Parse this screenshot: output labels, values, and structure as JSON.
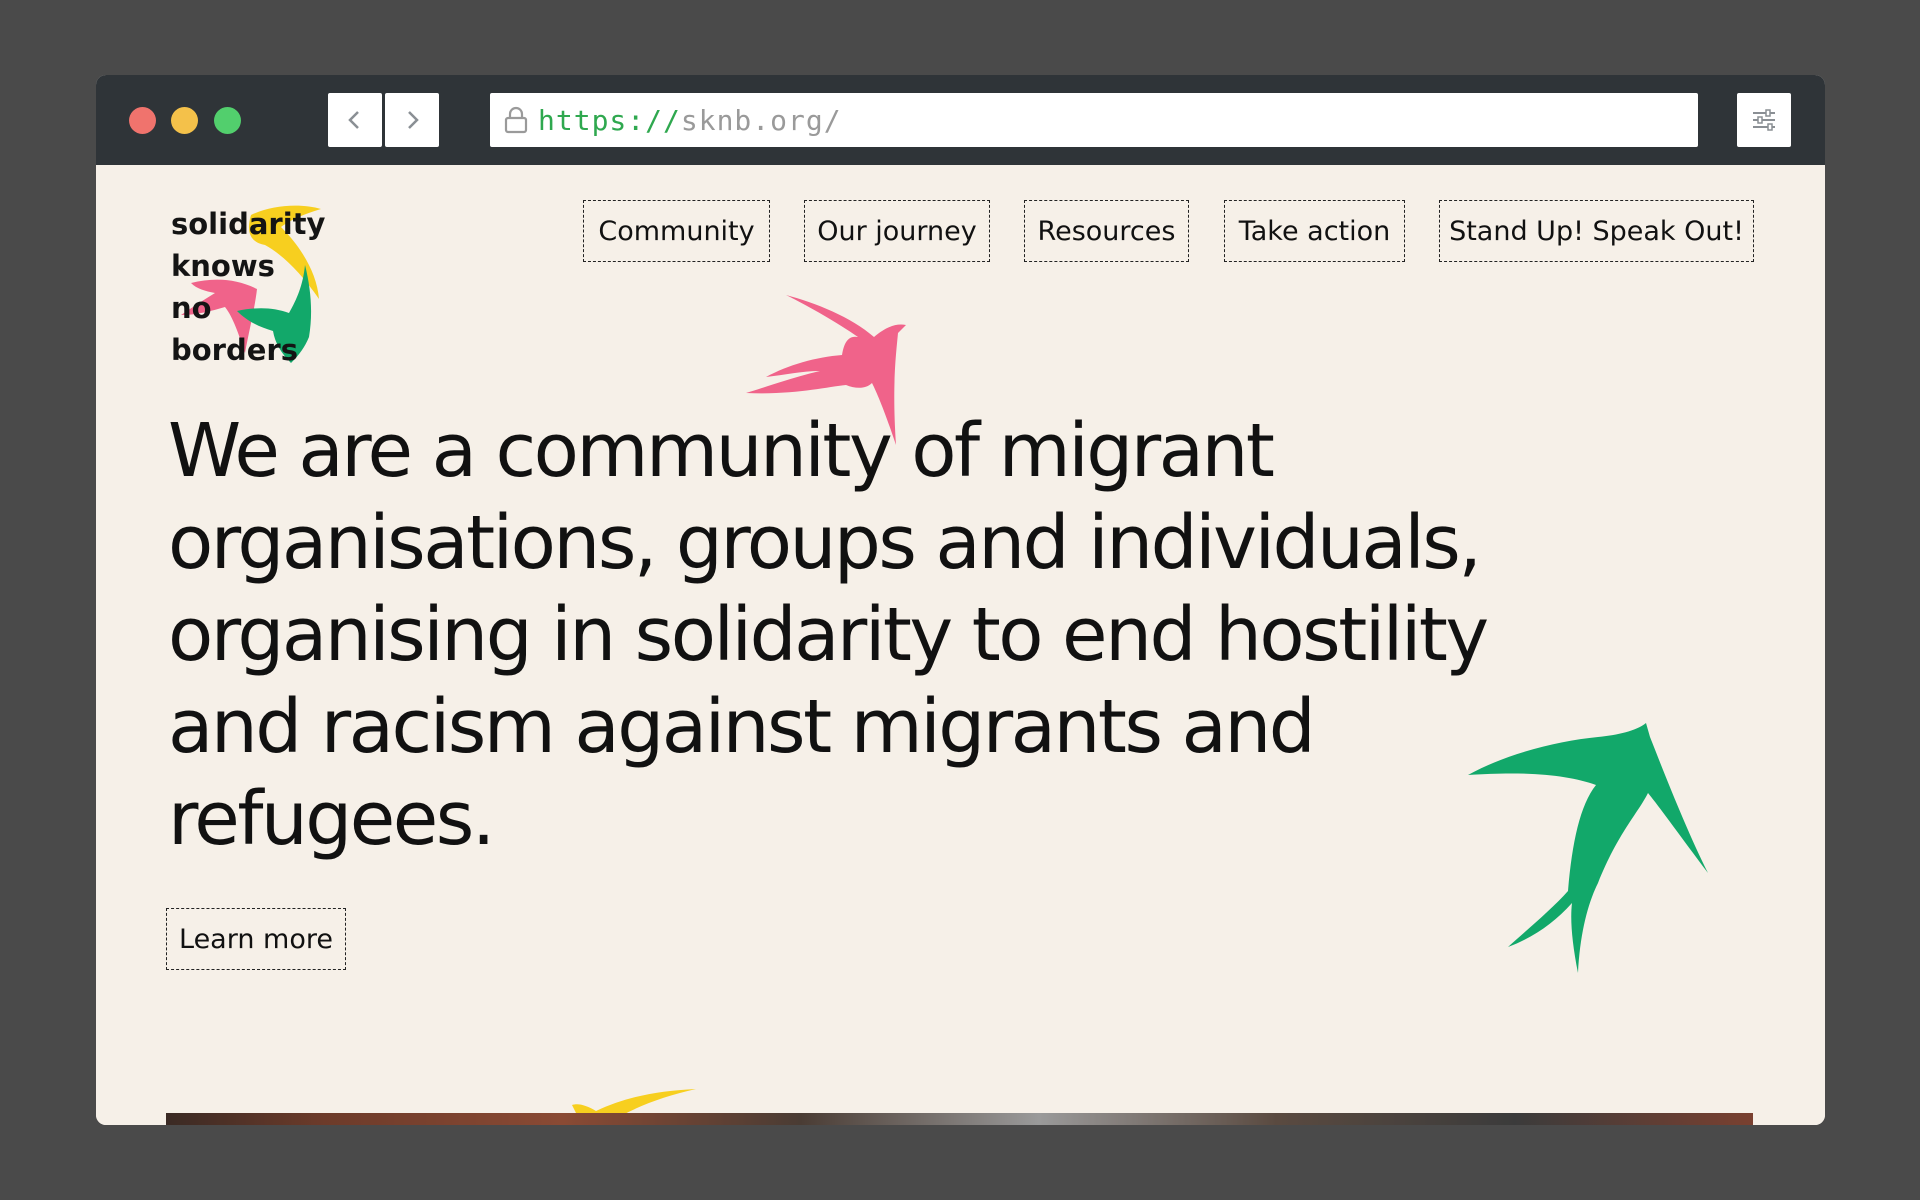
{
  "browser": {
    "url_scheme": "https://",
    "url_host": "sknb.org/"
  },
  "logo": {
    "lines": [
      "solidarity",
      "knows",
      "no",
      "borders"
    ]
  },
  "nav": {
    "items": [
      {
        "label": "Community"
      },
      {
        "label": "Our journey"
      },
      {
        "label": "Resources"
      },
      {
        "label": "Take action"
      },
      {
        "label": "Stand Up! Speak Out!"
      }
    ]
  },
  "hero": {
    "lines": [
      "We are a community of migrant",
      "organisations, groups and individuals,",
      "organising in solidarity to end hostility",
      "and racism against migrants and",
      "refugees."
    ],
    "cta": "Learn more"
  },
  "colors": {
    "background": "#f6f0e8",
    "pink_bird": "#f0638a",
    "green_bird": "#12a86a",
    "yellow_bird": "#f7cf1f",
    "chrome": "#2f3438"
  },
  "icons": {
    "lock": "lock-icon",
    "back": "chevron-left-icon",
    "forward": "chevron-right-icon",
    "menu": "sliders-icon"
  }
}
